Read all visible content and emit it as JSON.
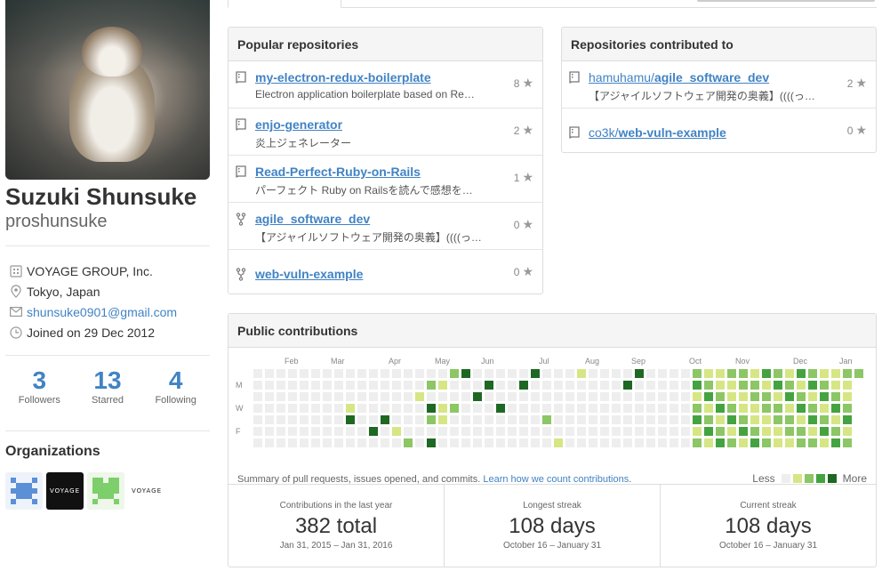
{
  "profile": {
    "fullname": "Suzuki Shunsuke",
    "username": "proshunsuke",
    "organization": "VOYAGE GROUP, Inc.",
    "location": "Tokyo, Japan",
    "email": "shunsuke0901@gmail.com",
    "joined": "Joined on 29 Dec 2012"
  },
  "stats": [
    {
      "num": "3",
      "label": "Followers"
    },
    {
      "num": "13",
      "label": "Starred"
    },
    {
      "num": "4",
      "label": "Following"
    }
  ],
  "organizations": {
    "title": "Organizations",
    "items": [
      {
        "name": "org-1"
      },
      {
        "name": "VOYAGE GROUP",
        "text": "VOYAGE"
      },
      {
        "name": "org-3"
      },
      {
        "name": "VOYAGE MARKETING",
        "text": "VOYAGE"
      }
    ]
  },
  "popular": {
    "title": "Popular repositories",
    "repos": [
      {
        "icon": "repo-icon",
        "name": "my-electron-redux-boilerplate",
        "desc": "Electron application boilerplate based on Re…",
        "stars": "8"
      },
      {
        "icon": "repo-icon",
        "name": "enjo-generator",
        "desc": "炎上ジェネレーター",
        "stars": "2"
      },
      {
        "icon": "repo-icon",
        "name": "Read-Perfect-Ruby-on-Rails",
        "desc": "パーフェクト Ruby on Railsを読んで感想を…",
        "stars": "1"
      },
      {
        "icon": "fork-icon",
        "name": "agile_software_dev",
        "desc": "【アジャイルソフトウェア開発の奥義】((((っ…",
        "stars": "0"
      },
      {
        "icon": "fork-icon",
        "name": "web-vuln-example",
        "desc": "",
        "stars": "0"
      }
    ]
  },
  "contributed": {
    "title": "Repositories contributed to",
    "repos": [
      {
        "owner": "hamuhamu/",
        "name": "agile_software_dev",
        "desc": "【アジャイルソフトウェア開発の奥義】((((っ…",
        "stars": "2"
      },
      {
        "owner": "co3k/",
        "name": "web-vuln-example",
        "desc": "",
        "stars": "0"
      }
    ]
  },
  "contributions": {
    "title": "Public contributions",
    "months": [
      "Feb",
      "Mar",
      "Apr",
      "May",
      "Jun",
      "Jul",
      "Aug",
      "Sep",
      "Oct",
      "Nov",
      "Dec",
      "Jan"
    ],
    "days": [
      "M",
      "W",
      "F"
    ],
    "summary": "Summary of pull requests, issues opened, and commits.",
    "learn_link": "Learn how we count contributions",
    "legend_less": "Less",
    "legend_more": "More",
    "colors": [
      "#eeeeee",
      "#d6e685",
      "#8cc665",
      "#44a340",
      "#1e6823"
    ],
    "streaks": [
      {
        "label": "Contributions in the last year",
        "value": "382 total",
        "range": "Jan 31, 2015 – Jan 31, 2016"
      },
      {
        "label": "Longest streak",
        "value": "108 days",
        "range": "October 16 – January 31"
      },
      {
        "label": "Current streak",
        "value": "108 days",
        "range": "October 16 – January 31"
      }
    ]
  }
}
